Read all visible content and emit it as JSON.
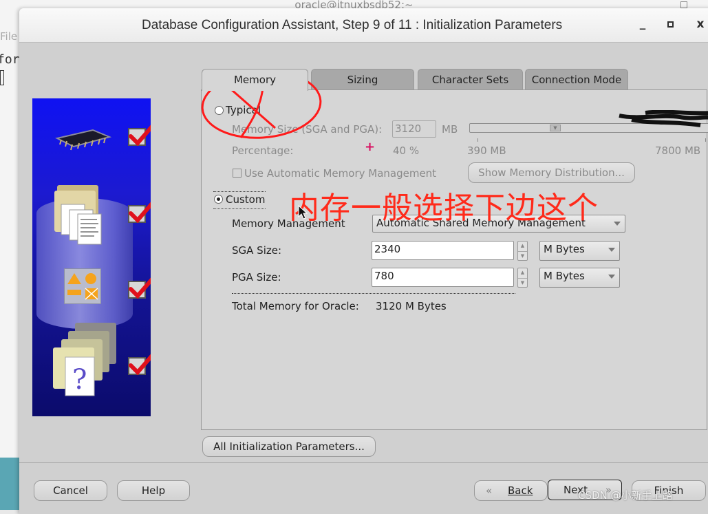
{
  "background_terminal": {
    "title": "oracle@itnuxbsdb52:~",
    "menu_fragment": "File",
    "text_fragment": "for"
  },
  "window": {
    "title": "Database Configuration Assistant, Step 9 of 11 : Initialization Parameters",
    "minimize_glyph": "_",
    "close_glyph": "x"
  },
  "tabs": [
    {
      "label": "Memory",
      "active": true
    },
    {
      "label": "Sizing",
      "active": false
    },
    {
      "label": "Character Sets",
      "active": false
    },
    {
      "label": "Connection Mode",
      "active": false
    }
  ],
  "memory": {
    "typical": {
      "label": "Typical",
      "selected": false,
      "memory_size_label": "Memory Size (SGA and PGA):",
      "memory_size_value": "3120",
      "memory_size_unit": "MB",
      "slider_min_label": "390 MB",
      "slider_max_label": "7800 MB",
      "slider_value_mb": 3120,
      "percentage_label": "Percentage:",
      "percentage_value": "40 %",
      "amm_checkbox_label": "Use Automatic Memory Management",
      "amm_checked": false,
      "show_distribution_button": "Show Memory Distribution..."
    },
    "custom": {
      "label": "Custom",
      "selected": true,
      "memory_management_label": "Memory Management",
      "memory_management_value": "Automatic Shared Memory Management",
      "sga_label": "SGA Size:",
      "sga_value": "2340",
      "sga_unit": "M Bytes",
      "pga_label": "PGA Size:",
      "pga_value": "780",
      "pga_unit": "M Bytes",
      "total_label": "Total Memory for Oracle:",
      "total_value": "3120 M Bytes"
    }
  },
  "steps_sidebar": {
    "items": [
      {
        "icon": "memory-chip",
        "checked": true
      },
      {
        "icon": "database-files",
        "checked": true
      },
      {
        "icon": "character-sets",
        "checked": true
      },
      {
        "icon": "help-documents",
        "checked": true
      }
    ]
  },
  "buttons": {
    "all_init_params": "All Initialization Parameters...",
    "cancel": "Cancel",
    "help": "Help",
    "back": "Back",
    "next": "Next",
    "finish": "Finish"
  },
  "annotation": {
    "text": "内存一般选择下边这个",
    "color": "#ff2a1a"
  },
  "watermark": "CSDN @小新手上路"
}
